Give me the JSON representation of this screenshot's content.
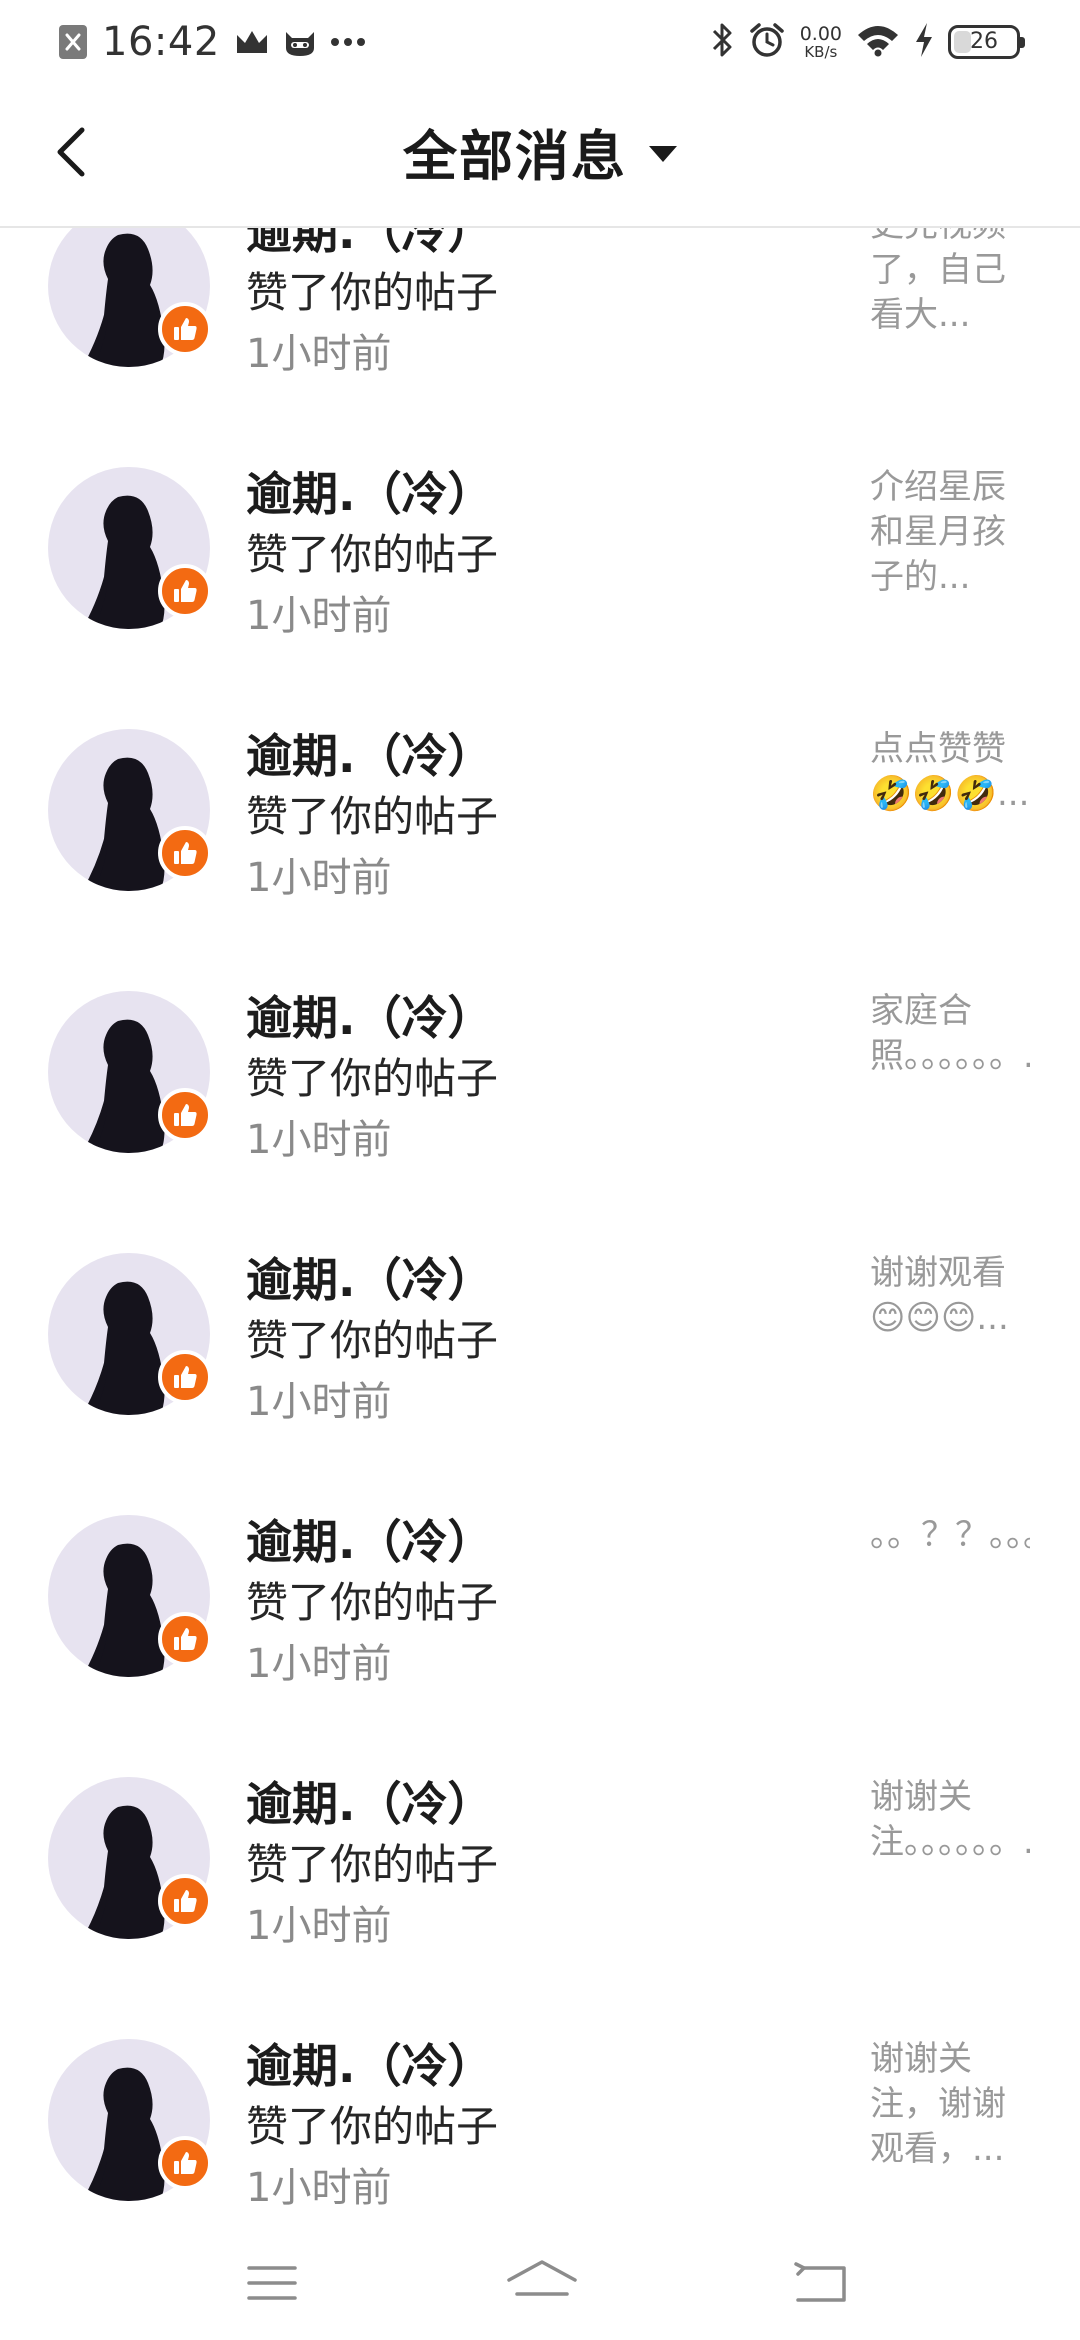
{
  "status_bar": {
    "time": "16:42",
    "left_icons": [
      "close-box-icon",
      "crown-icon",
      "cat-face-icon",
      "more-dots-icon"
    ],
    "right_icons": [
      "bluetooth-icon",
      "alarm-icon",
      "wifi-icon",
      "charging-icon"
    ],
    "net_speed_value": "0.00",
    "net_speed_unit": "KB/s",
    "battery_level": "26"
  },
  "header": {
    "title": "全部消息",
    "back_icon": "chevron-left-icon",
    "dropdown_icon": "caret-down-icon"
  },
  "messages": [
    {
      "user": "逾期.（冷）",
      "action": "赞了你的帖子",
      "time": "1小时前",
      "preview": "更完视频了，自己看大..."
    },
    {
      "user": "逾期.（冷）",
      "action": "赞了你的帖子",
      "time": "1小时前",
      "preview": "介绍星辰和星月孩子的..."
    },
    {
      "user": "逾期.（冷）",
      "action": "赞了你的帖子",
      "time": "1小时前",
      "preview": "点点赞赞🤣🤣🤣..."
    },
    {
      "user": "逾期.（冷）",
      "action": "赞了你的帖子",
      "time": "1小时前",
      "preview": "家庭合照。。。。。。..."
    },
    {
      "user": "逾期.（冷）",
      "action": "赞了你的帖子",
      "time": "1小时前",
      "preview": "谢谢观看😊😊😊..."
    },
    {
      "user": "逾期.（冷）",
      "action": "赞了你的帖子",
      "time": "1小时前",
      "preview": "。。？？。。。。。。..."
    },
    {
      "user": "逾期.（冷）",
      "action": "赞了你的帖子",
      "time": "1小时前",
      "preview": "谢谢关注。。。。。。..."
    },
    {
      "user": "逾期.（冷）",
      "action": "赞了你的帖子",
      "time": "1小时前",
      "preview": "谢谢关注，谢谢观看，..."
    }
  ],
  "nav": {
    "menu_icon": "menu-icon",
    "home_icon": "home-icon",
    "back_icon": "back-arrow-icon"
  },
  "colors": {
    "like_badge": "#f36a12",
    "avatar_bg": "#e7e3f0",
    "time_text": "#8a8a8a",
    "preview_text": "#999999"
  }
}
